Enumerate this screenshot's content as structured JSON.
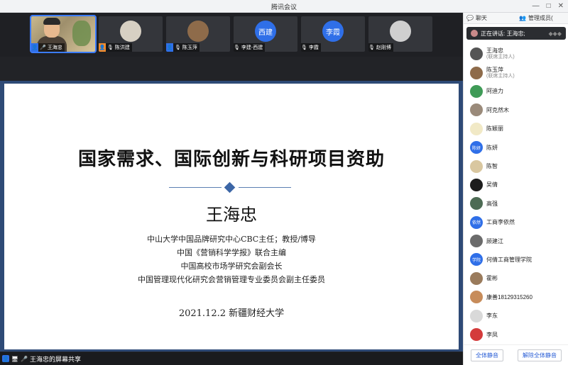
{
  "window": {
    "title": "腾讯会议",
    "min": "—",
    "max": "□",
    "close": "✕"
  },
  "gallery": [
    {
      "name": "王海忠",
      "initials": "",
      "color": "#3b7cff",
      "active": true
    },
    {
      "name": "陈洪建",
      "initials": "",
      "color": "#d7d0c3",
      "active": false
    },
    {
      "name": "陈玉萍",
      "initials": "",
      "color": "#8e6b4a",
      "active": false
    },
    {
      "name": "李建-西建",
      "initials": "西建",
      "color": "#2f6fe8",
      "active": false
    },
    {
      "name": "李霞",
      "initials": "李霞",
      "color": "#2f6fe8",
      "active": false
    },
    {
      "name": "赵刚博",
      "initials": "",
      "color": "#cfcfcf",
      "active": false
    }
  ],
  "slide": {
    "headline": "国家需求、国际创新与科研项目资助",
    "name": "王海忠",
    "titles": [
      "中山大学中国品牌研究中心CBC主任；教授/博导",
      "中国《营销科学学报》联合主编",
      "中国高校市场学研究会副会长",
      "中国管理现代化研究会营销管理专业委员会副主任委员"
    ],
    "date_line": "2021.12.2   新疆财经大学"
  },
  "status": {
    "share_text": "王海忠的屏幕共享"
  },
  "panel": {
    "tab_chat": "聊天",
    "tab_manage": "管理成员(",
    "speaking": "正在讲话: 王海忠;",
    "participants": [
      {
        "name": "王海忠",
        "role": "(联席主持人)",
        "initials": "",
        "color": "#555555"
      },
      {
        "name": "陈玉萍",
        "role": "(联席主持人)",
        "initials": "",
        "color": "#8e6b4a"
      },
      {
        "name": "阿迪力",
        "role": "",
        "initials": "",
        "color": "#3f9b57"
      },
      {
        "name": "阿克然木",
        "role": "",
        "initials": "",
        "color": "#9a8a7a"
      },
      {
        "name": "陈颖丽",
        "role": "",
        "initials": "",
        "color": "#f1e9c6"
      },
      {
        "name": "陈妍",
        "role": "",
        "initials": "陈妍",
        "color": "#2f6fe8"
      },
      {
        "name": "陈智",
        "role": "",
        "initials": "",
        "color": "#d9c7a0"
      },
      {
        "name": "吴倩",
        "role": "",
        "initials": "",
        "color": "#1d1d1d"
      },
      {
        "name": "高强",
        "role": "",
        "initials": "",
        "color": "#4d6b54"
      },
      {
        "name": "工商李依然",
        "role": "",
        "initials": "依然",
        "color": "#2f6fe8"
      },
      {
        "name": "顾建江",
        "role": "",
        "initials": "",
        "color": "#6b6b6b"
      },
      {
        "name": "何倩工商管理学院",
        "role": "",
        "initials": "学院",
        "color": "#2f6fe8"
      },
      {
        "name": "霍彬",
        "role": "",
        "initials": "",
        "color": "#9a7b5c"
      },
      {
        "name": "康善18129315260",
        "role": "",
        "initials": "",
        "color": "#c78c5a"
      },
      {
        "name": "李东",
        "role": "",
        "initials": "",
        "color": "#d9d9d9"
      },
      {
        "name": "李凤",
        "role": "",
        "initials": "",
        "color": "#d43b3b"
      }
    ],
    "mute_all": "全体静音",
    "unmute_all": "解除全体静音"
  }
}
